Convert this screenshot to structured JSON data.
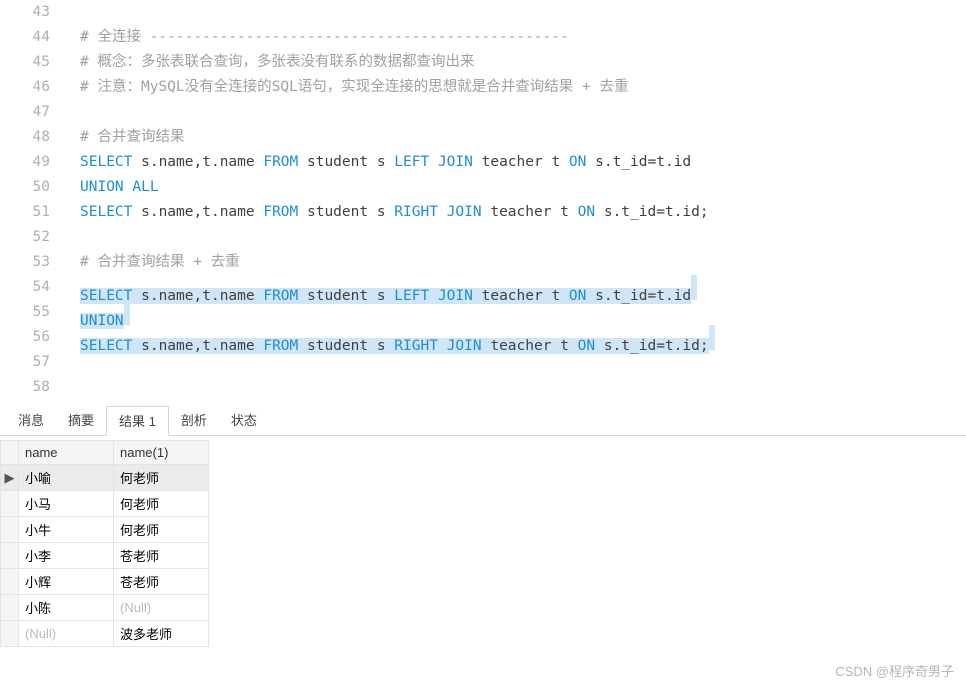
{
  "editor": {
    "lines": [
      {
        "num": "43",
        "tokens": []
      },
      {
        "num": "44",
        "tokens": [
          {
            "t": "comment",
            "v": "# 全连接 ------------------------------------------------"
          }
        ]
      },
      {
        "num": "45",
        "tokens": [
          {
            "t": "comment",
            "v": "# 概念：多张表联合查询，多张表没有联系的数据都查询出来"
          }
        ]
      },
      {
        "num": "46",
        "tokens": [
          {
            "t": "comment",
            "v": "# 注意：MySQL没有全连接的SQL语句，实现全连接的思想就是合并查询结果 + 去重"
          }
        ]
      },
      {
        "num": "47",
        "tokens": []
      },
      {
        "num": "48",
        "tokens": [
          {
            "t": "comment",
            "v": "# 合并查询结果"
          }
        ]
      },
      {
        "num": "49",
        "tokens": [
          {
            "t": "kw",
            "v": "SELECT"
          },
          {
            "t": "text",
            "v": " s.name,t.name "
          },
          {
            "t": "kw",
            "v": "FROM"
          },
          {
            "t": "text",
            "v": " student s "
          },
          {
            "t": "kw",
            "v": "LEFT"
          },
          {
            "t": "text",
            "v": " "
          },
          {
            "t": "kw",
            "v": "JOIN"
          },
          {
            "t": "text",
            "v": " teacher t "
          },
          {
            "t": "kw",
            "v": "ON"
          },
          {
            "t": "text",
            "v": " s.t_id=t.id"
          }
        ]
      },
      {
        "num": "50",
        "tokens": [
          {
            "t": "kw",
            "v": "UNION"
          },
          {
            "t": "text",
            "v": " "
          },
          {
            "t": "kw",
            "v": "ALL"
          }
        ]
      },
      {
        "num": "51",
        "tokens": [
          {
            "t": "kw",
            "v": "SELECT"
          },
          {
            "t": "text",
            "v": " s.name,t.name "
          },
          {
            "t": "kw",
            "v": "FROM"
          },
          {
            "t": "text",
            "v": " student s "
          },
          {
            "t": "kw",
            "v": "RIGHT"
          },
          {
            "t": "text",
            "v": " "
          },
          {
            "t": "kw",
            "v": "JOIN"
          },
          {
            "t": "text",
            "v": " teacher t "
          },
          {
            "t": "kw",
            "v": "ON"
          },
          {
            "t": "text",
            "v": " s.t_id=t.id;"
          }
        ]
      },
      {
        "num": "52",
        "tokens": []
      },
      {
        "num": "53",
        "tokens": [
          {
            "t": "comment",
            "v": "# 合并查询结果 + 去重"
          }
        ]
      },
      {
        "num": "54",
        "hl": true,
        "tokens": [
          {
            "t": "kw",
            "v": "SELECT"
          },
          {
            "t": "text",
            "v": " s.name,t.name "
          },
          {
            "t": "kw",
            "v": "FROM"
          },
          {
            "t": "text",
            "v": " student s "
          },
          {
            "t": "kw",
            "v": "LEFT"
          },
          {
            "t": "text",
            "v": " "
          },
          {
            "t": "kw",
            "v": "JOIN"
          },
          {
            "t": "text",
            "v": " teacher t "
          },
          {
            "t": "kw",
            "v": "ON"
          },
          {
            "t": "text",
            "v": " s.t_id=t.id"
          }
        ]
      },
      {
        "num": "55",
        "hl": true,
        "tokens": [
          {
            "t": "kw",
            "v": "UNION"
          }
        ]
      },
      {
        "num": "56",
        "hl": true,
        "tokens": [
          {
            "t": "kw",
            "v": "SELECT"
          },
          {
            "t": "text",
            "v": " s.name,t.name "
          },
          {
            "t": "kw",
            "v": "FROM"
          },
          {
            "t": "text",
            "v": " student s "
          },
          {
            "t": "kw",
            "v": "RIGHT"
          },
          {
            "t": "text",
            "v": " "
          },
          {
            "t": "kw",
            "v": "JOIN"
          },
          {
            "t": "text",
            "v": " teacher t "
          },
          {
            "t": "kw",
            "v": "ON"
          },
          {
            "t": "text",
            "v": " s.t_id=t.id;"
          }
        ]
      },
      {
        "num": "57",
        "tokens": []
      },
      {
        "num": "58",
        "tokens": []
      }
    ]
  },
  "tabs": {
    "items": [
      {
        "label": "消息",
        "active": false
      },
      {
        "label": "摘要",
        "active": false
      },
      {
        "label": "结果 1",
        "active": true
      },
      {
        "label": "剖析",
        "active": false
      },
      {
        "label": "状态",
        "active": false
      }
    ]
  },
  "grid": {
    "columns": [
      "name",
      "name(1)"
    ],
    "rows": [
      {
        "cells": [
          "小喻",
          "何老师"
        ],
        "selected": true
      },
      {
        "cells": [
          "小马",
          "何老师"
        ]
      },
      {
        "cells": [
          "小牛",
          "何老师"
        ]
      },
      {
        "cells": [
          "小李",
          "苍老师"
        ]
      },
      {
        "cells": [
          "小辉",
          "苍老师"
        ]
      },
      {
        "cells": [
          "小陈",
          null
        ]
      },
      {
        "cells": [
          null,
          "波多老师"
        ]
      }
    ],
    "null_label": "(Null)"
  },
  "watermark": "CSDN @程序奇男子"
}
